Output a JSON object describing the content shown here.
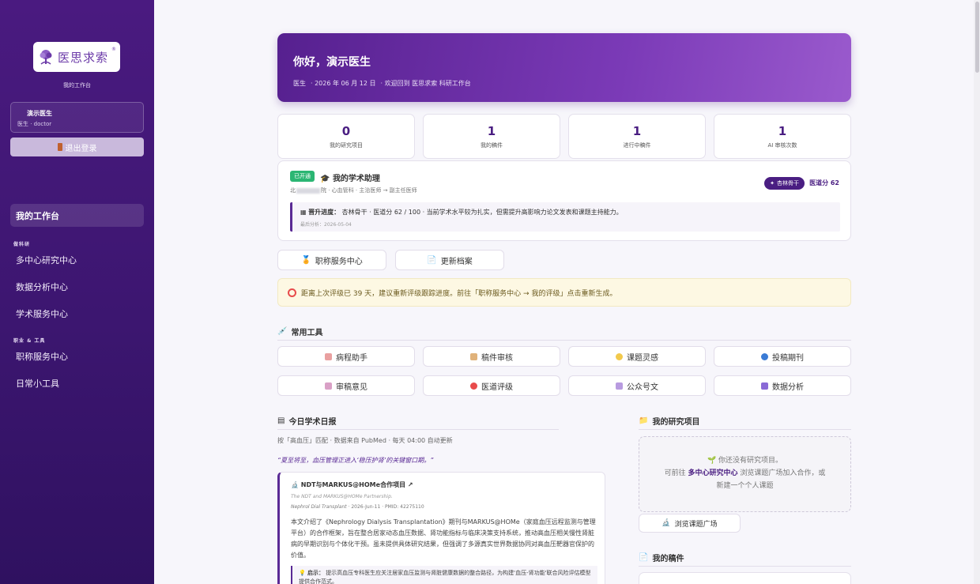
{
  "app": {
    "logo_text": "医思求索",
    "logo_mark": "®",
    "workspace_sub": "我的工作台"
  },
  "user": {
    "name": "演示医生",
    "role_line": "医生 · doctor",
    "logout_label": "退出登录"
  },
  "nav": {
    "active": "我的工作台",
    "section1": "做科研",
    "items1": [
      "多中心研究中心",
      "数据分析中心",
      "学术服务中心"
    ],
    "section2": "职业 & 工具",
    "items2": [
      "职称服务中心",
      "日常小工具"
    ]
  },
  "hero": {
    "title": "你好，演示医生",
    "role": "医生",
    "date": "· 2026 年 06 月 12 日",
    "welcome": "· 欢迎回到 医思求索 科研工作台"
  },
  "stats": [
    {
      "value": "0",
      "label": "我的研究项目"
    },
    {
      "value": "1",
      "label": "我的稿件"
    },
    {
      "value": "1",
      "label": "进行中稿件"
    },
    {
      "value": "1",
      "label": "AI 审核次数"
    }
  ],
  "assistant": {
    "badge": "已开通",
    "title": "我的学术助理",
    "info_prefix": "北",
    "info_suffix": "院 · 心血管科 · 主治医师 → 副主任医师",
    "tag": "杏林骨干",
    "score": "医道分 62",
    "progress_label": "晋升进度：",
    "progress_text": "杏林骨干 · 医道分 62 / 100 · 当前学术水平较为扎实，但需提升高影响力论文发表和课题主持能力。",
    "last_analysis": "最后分析：2026-05-04"
  },
  "buttons": {
    "title_service": "职称服务中心",
    "update_profile": "更新档案"
  },
  "notice": {
    "text": "距离上次评级已 39 天，建议重新评级跟踪进度。前往「职称服务中心 → 我的评级」点击重新生成。"
  },
  "tools": {
    "title": "常用工具",
    "items": [
      "病程助手",
      "稿件审核",
      "课题灵感",
      "投稿期刊",
      "审稿意见",
      "医道评级",
      "公众号文",
      "数据分析"
    ]
  },
  "digest": {
    "title": "今日学术日报",
    "subtitle": "按「高血压」匹配 · 数据来自 PubMed · 每天 04:00 自动更新",
    "quote": "“夏至将至，血压管理正进入‘稳压护肾’的关键窗口期。”",
    "article_title": "NDT与MARKUS@HOMe合作项目 ↗",
    "article_en": "The NDT and MARKUS@HOMe Partnership.",
    "article_journal": "Nephrol Dial Transplant",
    "article_meta": " · 2026-Jun-11 · PMID: 42275110",
    "article_body": "本文介绍了《Nephrology Dialysis Transplantation》期刊与MARKUS@HOMe（家庭血压远程监测与管理平台）的合作框架，旨在整合居家动态血压数据、肾功能指标与临床决策支持系统，推动高血压相关慢性肾脏病的早期识别与个体化干预。虽未提供具体研究结果，但强调了多源真实世界数据协同对高血压靶器官保护的价值。",
    "tip_label": "启示：",
    "tip_text": "提示高血压专科医生应关注居家血压监测与肾脏健康数据的整合路径，为构建'血压-肾功能'联合风险评估模型提供合作范式。"
  },
  "projects": {
    "title": "我的研究项目",
    "empty_line1": "你还没有研究项目。",
    "empty_line2a": "可前往 ",
    "empty_link": "多中心研究中心",
    "empty_line2b": " 浏览课题广场加入合作，或",
    "empty_line3": "新建一个个人课题",
    "browse_label": "浏览课题广场"
  },
  "manuscripts": {
    "title": "我的稿件"
  },
  "colors": {
    "primary": "#4a1e82",
    "accent": "#7b3ab7",
    "success": "#2bb673",
    "notice_bg": "#fdf8e3"
  }
}
